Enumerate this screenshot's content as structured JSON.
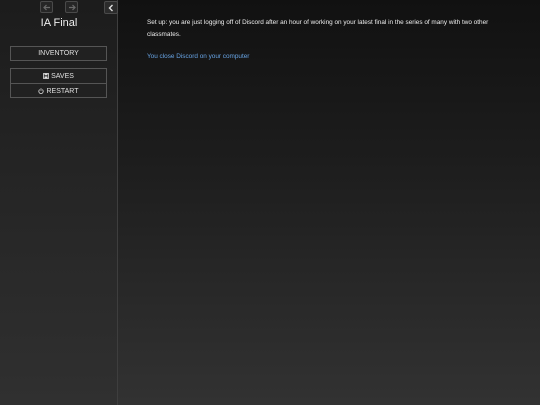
{
  "sidebar": {
    "story_title": "IA Final",
    "history_back_icon": "arrow-left-icon",
    "history_forward_icon": "arrow-right-icon",
    "toggle_icon": "chevron-left-icon",
    "inventory_label": "INVENTORY",
    "saves_label": "SAVES",
    "saves_icon": "floppy-disk-icon",
    "restart_label": "RESTART",
    "restart_icon": "power-icon"
  },
  "passage": {
    "text": "Set up: you are just logging off of Discord after an hour of working on your latest final in the series of many with two other classmates.",
    "link_text": "You close Discord on your computer"
  },
  "colors": {
    "link": "#68a5e6",
    "text": "#eeeeee",
    "sidebar_bg": "#222222"
  }
}
